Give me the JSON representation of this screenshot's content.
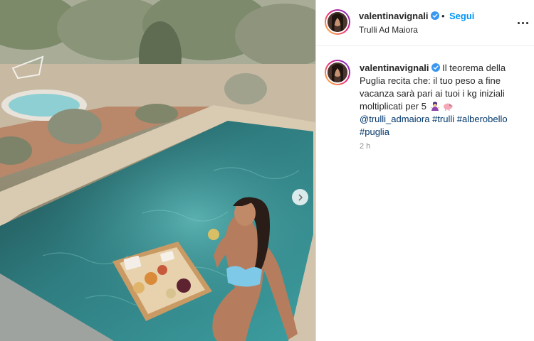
{
  "post": {
    "username": "valentinavignali",
    "separator": "•",
    "follow_label": "Segui",
    "location": "Trulli Ad Maiora",
    "caption_text_1": "Il teorema della Puglia recita che: il tuo peso a fine vacanza sarà pari ai tuoi i kg iniziali moltiplicati per 5",
    "mention": "@trulli_admaiora",
    "hashtags": [
      "#trulli",
      "#alberobello",
      "#puglia"
    ],
    "timestamp": "2 h"
  },
  "icons": {
    "verified": "verified-badge-icon",
    "more": "more-options-icon",
    "next": "chevron-right-icon",
    "emoji_1": "woman-shrugging-emoji-icon",
    "emoji_2": "pig-emoji-icon"
  },
  "colors": {
    "accent": "#0095f6",
    "link": "#00376b",
    "verified": "#3897f0",
    "text": "#262626",
    "muted": "#8e8e8e"
  }
}
